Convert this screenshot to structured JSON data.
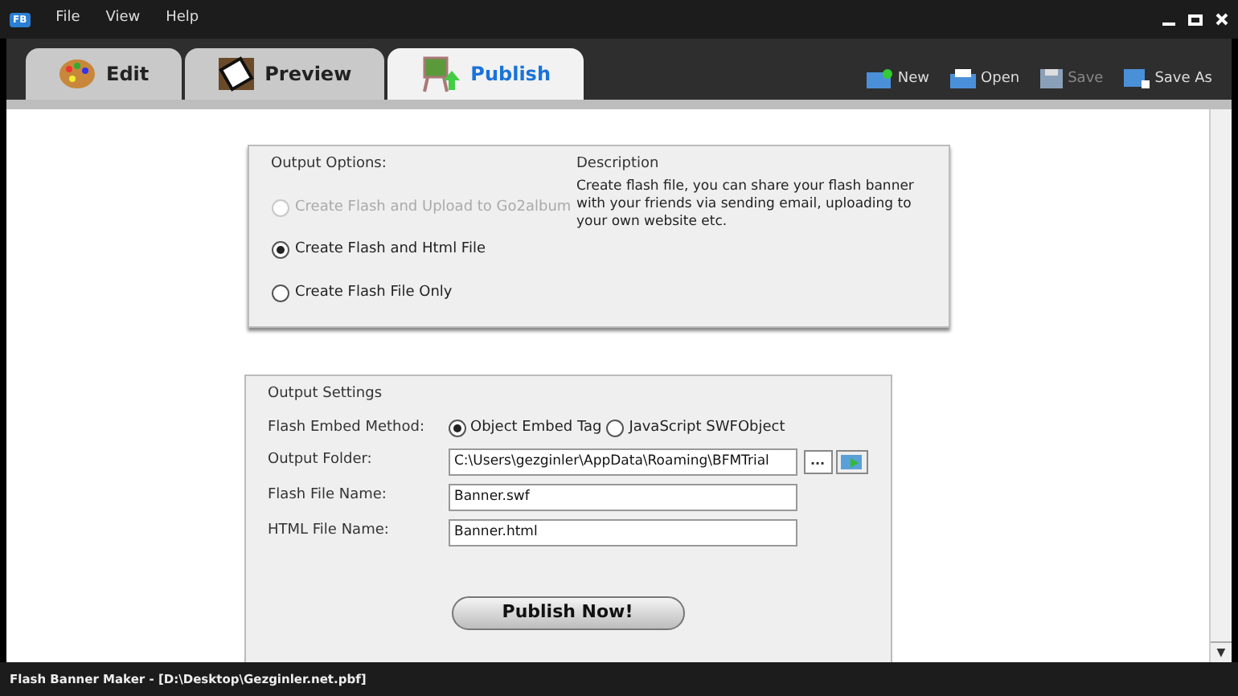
{
  "app_icon": "FB",
  "menu": [
    "File",
    "View",
    "Help"
  ],
  "tabs": [
    {
      "label": "Edit",
      "selected": false,
      "kind": "edit"
    },
    {
      "label": "Preview",
      "selected": false,
      "kind": "preview"
    },
    {
      "label": "Publish",
      "selected": true,
      "kind": "publish"
    }
  ],
  "toolbar": [
    {
      "label": "New",
      "disabled": false,
      "kind": "new"
    },
    {
      "label": "Open",
      "disabled": false,
      "kind": "open"
    },
    {
      "label": "Save",
      "disabled": true,
      "kind": "save"
    },
    {
      "label": "Save As",
      "disabled": false,
      "kind": "saveas"
    }
  ],
  "output_options": {
    "title": "Output Options:",
    "options": [
      {
        "label": "Create Flash and Upload to Go2album",
        "selected": false,
        "disabled": true
      },
      {
        "label": "Create Flash and Html File",
        "selected": true,
        "disabled": false
      },
      {
        "label": "Create Flash File Only",
        "selected": false,
        "disabled": false
      }
    ],
    "description_title": "Description",
    "description": "Create flash file, you can share your flash banner with your friends via sending email, uploading to your own website etc."
  },
  "output_settings": {
    "title": "Output Settings",
    "embed_label": "Flash Embed Method:",
    "embed_methods": [
      {
        "label": "Object Embed Tag",
        "selected": true
      },
      {
        "label": "JavaScript SWFObject",
        "selected": false
      }
    ],
    "folder_label": "Output Folder:",
    "folder_value": "C:\\Users\\gezginler\\AppData\\Roaming\\BFMTrial",
    "browse_label": "...",
    "flash_label": "Flash File Name:",
    "flash_value": "Banner.swf",
    "html_label": "HTML File Name:",
    "html_value": "Banner.html",
    "publish_button": "Publish Now!"
  },
  "scroll_down": "▼",
  "status_bar": "Flash Banner Maker - [D:\\Desktop\\Gezginler.net.pbf]"
}
